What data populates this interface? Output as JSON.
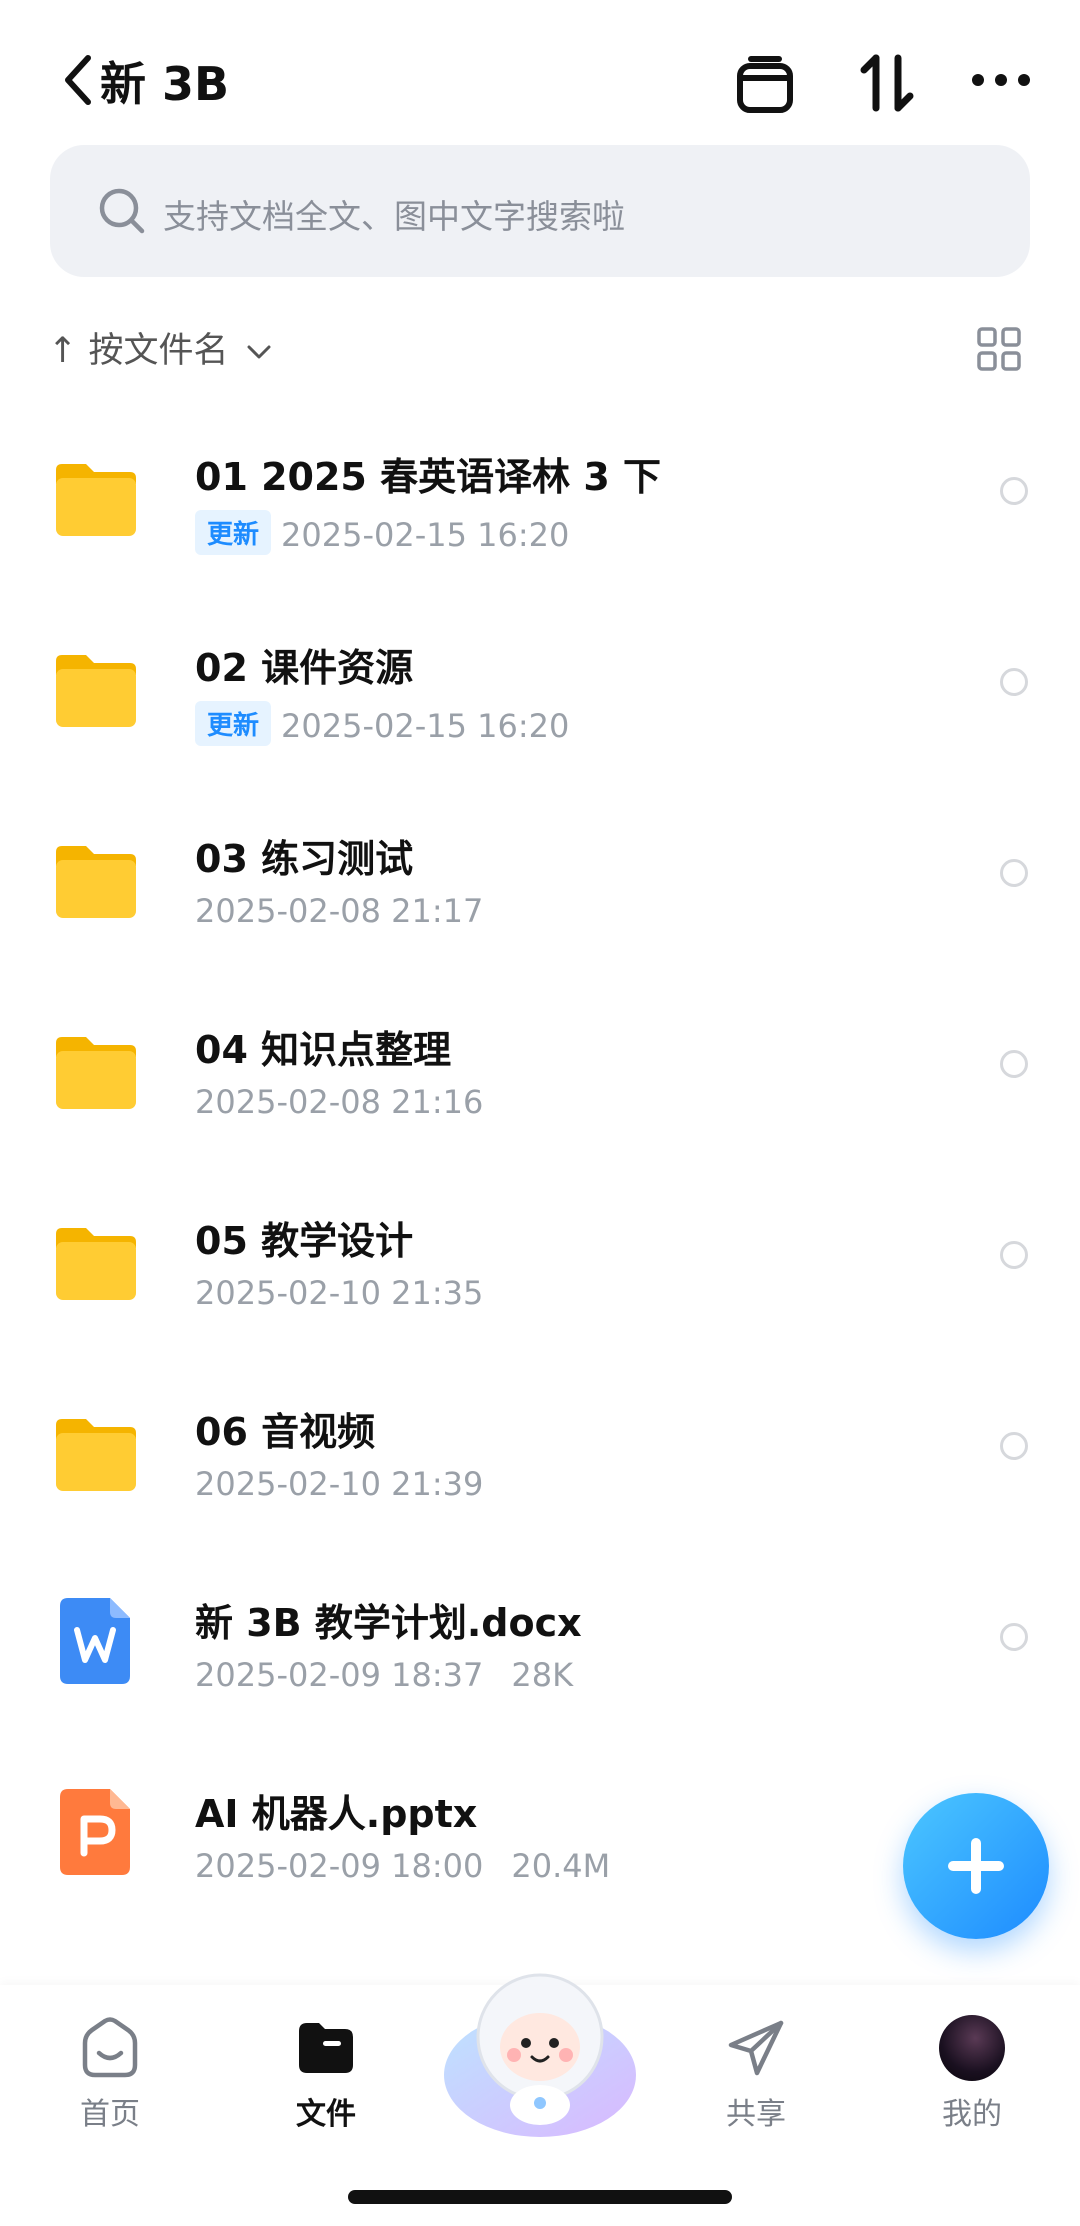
{
  "header": {
    "title": "新 3B"
  },
  "search": {
    "placeholder": "支持文档全文、图中文字搜索啦"
  },
  "sort": {
    "label": "按文件名"
  },
  "files": [
    {
      "name": "01 2025 春英语译林 3 下",
      "badge": "更新",
      "date": "2025-02-15 16:20",
      "size": "",
      "type": "folder"
    },
    {
      "name": "02 课件资源",
      "badge": "更新",
      "date": "2025-02-15 16:20",
      "size": "",
      "type": "folder"
    },
    {
      "name": "03 练习测试",
      "badge": "",
      "date": "2025-02-08 21:17",
      "size": "",
      "type": "folder"
    },
    {
      "name": "04 知识点整理",
      "badge": "",
      "date": "2025-02-08 21:16",
      "size": "",
      "type": "folder"
    },
    {
      "name": "05 教学设计",
      "badge": "",
      "date": "2025-02-10 21:35",
      "size": "",
      "type": "folder"
    },
    {
      "name": "06 音视频",
      "badge": "",
      "date": "2025-02-10 21:39",
      "size": "",
      "type": "folder"
    },
    {
      "name": "新 3B 教学计划.docx",
      "badge": "",
      "date": "2025-02-09 18:37",
      "size": "28K",
      "type": "docx"
    },
    {
      "name": "AI 机器人.pptx",
      "badge": "",
      "date": "2025-02-09 18:00",
      "size": "20.4M",
      "type": "pptx"
    }
  ],
  "nav": {
    "home": "首页",
    "files": "文件",
    "share": "共享",
    "mine": "我的"
  },
  "icons": {
    "back": "chevron-left-icon",
    "box": "archive-box-icon",
    "sort": "sort-arrows-icon",
    "more": "more-dots-icon",
    "search": "search-icon",
    "grid": "grid-view-icon",
    "add": "plus-icon"
  },
  "colors": {
    "accent": "#1e8cff",
    "folder": "#ffcc33",
    "word": "#3d8bf5",
    "ppt": "#ff7a3d"
  }
}
